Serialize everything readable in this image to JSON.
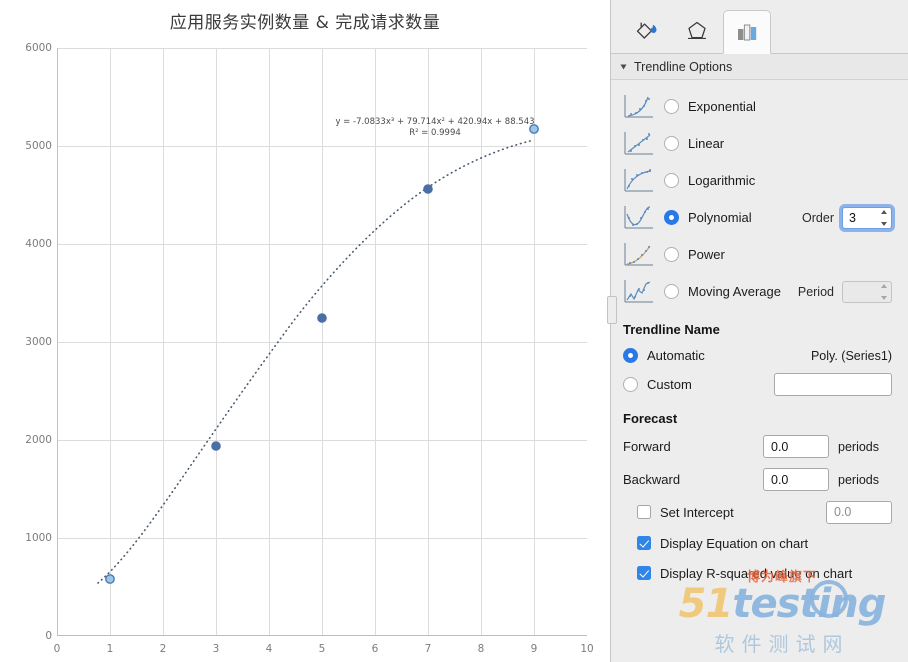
{
  "chart_data": {
    "type": "scatter",
    "title": "应用服务实例数量 & 完成请求数量",
    "xlabel": "",
    "ylabel": "",
    "x": [
      1,
      3,
      5,
      7,
      9
    ],
    "values": [
      580,
      1940,
      3250,
      4560,
      5170
    ],
    "series": [
      {
        "name": "Series1",
        "values": [
          580,
          1940,
          3250,
          4560,
          5170
        ]
      }
    ],
    "xlim": [
      0,
      10
    ],
    "ylim": [
      0,
      6000
    ],
    "xticks": [
      "0",
      "1",
      "2",
      "3",
      "4",
      "5",
      "6",
      "7",
      "8",
      "9",
      "10"
    ],
    "yticks": [
      "0",
      "1000",
      "2000",
      "3000",
      "4000",
      "5000",
      "6000"
    ],
    "grid": true,
    "legend": "none",
    "trendline": {
      "kind": "polynomial",
      "order": 3,
      "equation": "y = -7.0833x³ + 79.714x² + 420.94x + 88.543",
      "r_squared": "R² = 0.9994",
      "equation_parts": {
        "a3": "-7.0833",
        "a2": "79.714",
        "a1": "420.94",
        "a0": "88.543",
        "r2_value": "0.9994"
      }
    },
    "colors": {
      "marker": "#4a79b8",
      "trendline": "#44566b",
      "grid": "#d8d8d8",
      "axis": "#bfbfbf",
      "tick_text": "#7c7c7c"
    }
  },
  "panel": {
    "tabs": [
      {
        "name": "fill-and-line",
        "icon": "paint-bucket-icon",
        "selected": false
      },
      {
        "name": "effects",
        "icon": "pentagon-icon",
        "selected": false
      },
      {
        "name": "chart-options",
        "icon": "bar-chart-icon",
        "selected": true
      }
    ],
    "section_title": "Trendline Options",
    "trendline_types": [
      {
        "label": "Exponential",
        "selected": false
      },
      {
        "label": "Linear",
        "selected": false
      },
      {
        "label": "Logarithmic",
        "selected": false
      },
      {
        "label": "Polynomial",
        "selected": true
      },
      {
        "label": "Power",
        "selected": false
      },
      {
        "label": "Moving Average",
        "selected": false
      }
    ],
    "order": {
      "label": "Order",
      "value": "3",
      "focused": true
    },
    "period": {
      "label": "Period",
      "value": "",
      "disabled": true
    },
    "trendline_name": {
      "title": "Trendline Name",
      "automatic_label": "Automatic",
      "automatic_selected": true,
      "automatic_value": "Poly. (Series1)",
      "custom_label": "Custom",
      "custom_selected": false,
      "custom_value": ""
    },
    "forecast": {
      "title": "Forecast",
      "forward_label": "Forward",
      "forward_value": "0.0",
      "forward_unit": "periods",
      "backward_label": "Backward",
      "backward_value": "0.0",
      "backward_unit": "periods",
      "set_intercept_label": "Set Intercept",
      "set_intercept_checked": false,
      "set_intercept_value": "0.0"
    },
    "display_options": [
      {
        "label": "Display Equation on chart",
        "checked": true
      },
      {
        "label": "Display R-squared value on chart",
        "checked": true
      }
    ]
  },
  "watermark": {
    "top": "博为峰旗下",
    "brand_1": "51",
    "brand_2": "testing",
    "bottom": "软件测试网"
  },
  "colors": {
    "accent": "#2878e8",
    "checkbox": "#2f86e8",
    "panel_bg": "#ededed"
  }
}
